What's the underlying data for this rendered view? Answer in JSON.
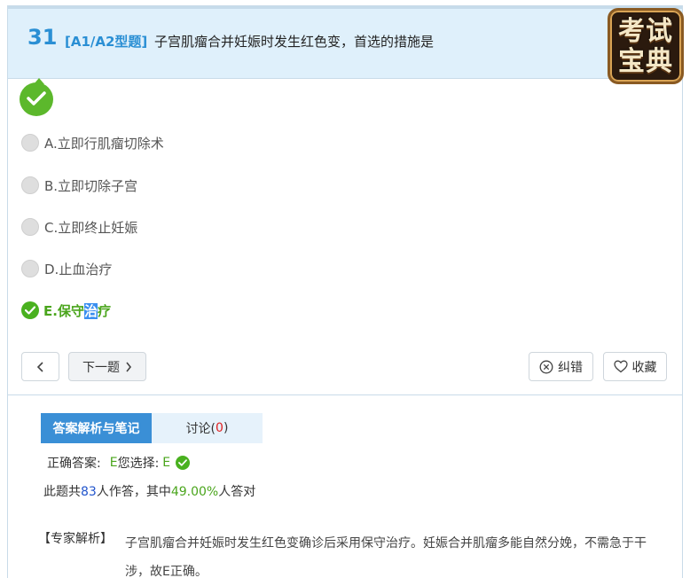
{
  "question": {
    "number": "31",
    "type": "[A1/A2型题]",
    "text": "子宫肌瘤合并妊娠时发生红色变，首选的措施是"
  },
  "logo": {
    "line1": "考试",
    "line2": "宝典"
  },
  "options": [
    {
      "label": "A.立即行肌瘤切除术",
      "state": "unselected"
    },
    {
      "label": "B.立即切除子宫",
      "state": "unselected"
    },
    {
      "label": "C.立即终止妊娠",
      "state": "unselected"
    },
    {
      "label": "D.止血治疗",
      "state": "unselected"
    },
    {
      "label_pre": "E.保守",
      "label_hl": "治",
      "label_post": "疗",
      "state": "correct"
    }
  ],
  "buttons": {
    "prev_icon": "chevron-left-icon",
    "next_label": "下一题",
    "report_label": "纠错",
    "favorite_label": "收藏"
  },
  "tabs": {
    "analysis": "答案解析与笔记",
    "discussion_label": "讨论(",
    "discussion_count": "0",
    "discussion_close": ")"
  },
  "answer": {
    "correct_label": "正确答案:",
    "correct_value": "E",
    "your_label": "您选择:",
    "your_value": "E"
  },
  "stats": {
    "pre": "此题共",
    "count": "83",
    "mid": "人作答，其中",
    "percent": "49.00%",
    "post": "人答对"
  },
  "explanation": {
    "label": "【专家解析】",
    "text": "子宫肌瘤合并妊娠时发生红色变确诊后采用保守治疗。妊娠合并肌瘤多能自然分娩，不需急于干涉，故E正确。"
  },
  "colors": {
    "accent_blue": "#2a8fd4",
    "correct_green": "#49b11f",
    "header_bg": "#dff0fb",
    "tab_active": "#3a8fd6"
  }
}
